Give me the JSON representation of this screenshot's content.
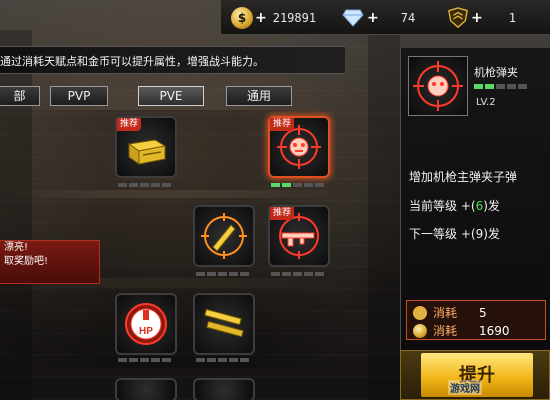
{
  "topbar": {
    "coins": "219891",
    "diamonds": "74",
    "rank_points": "1",
    "plus": "+"
  },
  "info_text": "通过消耗天赋点和金币可以提升属性，增强战斗能力。",
  "tabs": [
    {
      "label": "部",
      "active": false
    },
    {
      "label": "PVP",
      "active": false
    },
    {
      "label": "PVE",
      "active": true
    },
    {
      "label": "通用",
      "active": false
    }
  ],
  "recommend_badge": "推荐",
  "notice": {
    "line1": "漂亮!",
    "line2": "取奖励吧!"
  },
  "skills": [
    {
      "name": "ammo-crate",
      "recommended": true,
      "level": 0
    },
    {
      "name": "machine-gun-magazine",
      "recommended": true,
      "level": 2,
      "selected": true
    },
    {
      "name": "knife-skill",
      "recommended": false,
      "level": 0
    },
    {
      "name": "rifle-skill",
      "recommended": true,
      "level": 0
    },
    {
      "name": "hp-boost",
      "recommended": false,
      "level": 0
    },
    {
      "name": "ammo-clips",
      "recommended": false,
      "level": 0
    }
  ],
  "detail": {
    "name": "机枪弹夹",
    "level_label": "LV.2",
    "level": 2,
    "max_level": 5,
    "description": "增加机枪主弹夹子弹",
    "current_prefix": "当前等级 +(",
    "current_value": "6",
    "current_suffix": ")发",
    "next_prefix": "下一等级 +(",
    "next_value": "9",
    "next_suffix": ")发",
    "cost_label": "消耗",
    "cost_talent": "5",
    "cost_gold": "1690",
    "upgrade_label": "提升"
  },
  "watermark": "游戏网",
  "colors": {
    "level_on": "#5bd86a",
    "selected_border": "#e05020",
    "accent_red": "#c42a1a",
    "upgrade_gold": "#f2b81a",
    "value_green": "#4fe04f"
  }
}
